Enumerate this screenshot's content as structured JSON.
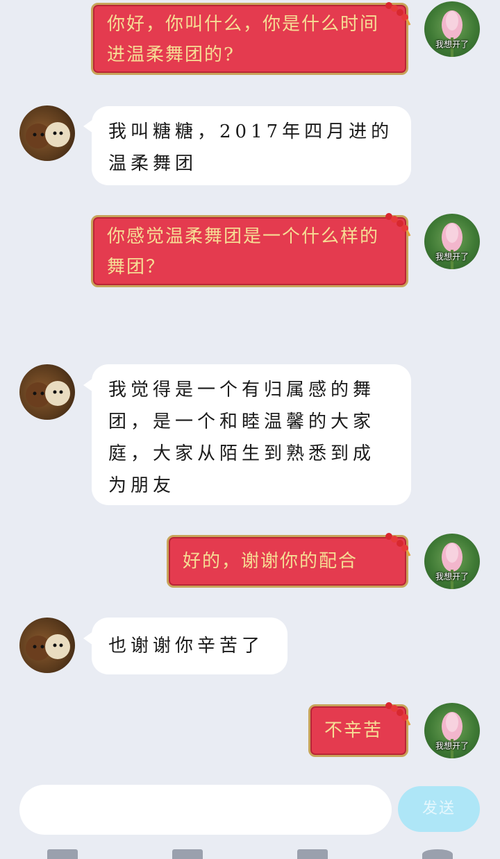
{
  "messages": [
    {
      "side": "self",
      "text": "你好，你叫什么，你是什么时间进温柔舞团的?"
    },
    {
      "side": "other",
      "text": "我叫糖糖，2017年四月进的温柔舞团"
    },
    {
      "side": "self",
      "text": "你感觉温柔舞团是一个什么样的舞团？"
    },
    {
      "side": "other",
      "text": "我觉得是一个有归属感的舞团，是一个和睦温馨的大家庭，大家从陌生到熟悉到成为朋友"
    },
    {
      "side": "self",
      "text": "好的，谢谢你的配合"
    },
    {
      "side": "other",
      "text": "也谢谢你辛苦了"
    },
    {
      "side": "self",
      "text": "不辛苦"
    }
  ],
  "self_avatar_label": "我想开了",
  "composer": {
    "send_label": "发送",
    "placeholder": ""
  },
  "colors": {
    "self_bubble": "#e43b4f",
    "self_text": "#f6dd95",
    "other_bubble": "#ffffff",
    "background": "#e9ecf3",
    "send_button": "#aee6f7"
  },
  "icons": [
    "lotus-avatar",
    "poodles-avatar",
    "firecracker-decoration"
  ]
}
